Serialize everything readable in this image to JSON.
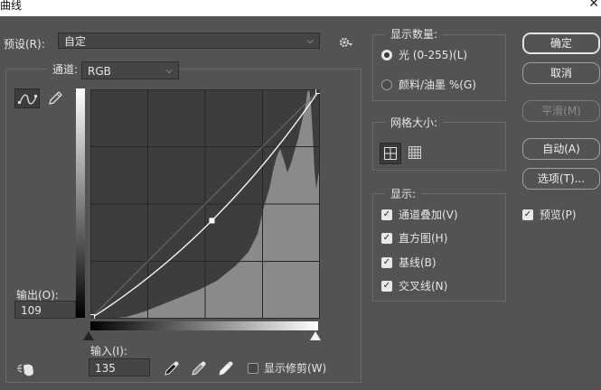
{
  "window": {
    "title": "曲线",
    "close_glyph": "✕"
  },
  "preset": {
    "label": "预设(R):",
    "value": "自定",
    "settings_icon": "gear-icon"
  },
  "channel": {
    "label": "通道:",
    "value": "RGB"
  },
  "tools": {
    "curve_tool": "curve-point-icon",
    "pencil_tool": "pencil-icon"
  },
  "output": {
    "label": "输出(O):",
    "value": "109"
  },
  "input": {
    "label": "输入(I):",
    "value": "135"
  },
  "eyedroppers": [
    "black-point-eyedropper-icon",
    "gray-point-eyedropper-icon",
    "white-point-eyedropper-icon"
  ],
  "show_clipping": {
    "label": "显示修剪(W)",
    "checked": false
  },
  "display_amount": {
    "title": "显示数量:",
    "light": "光 (0-255)(L)",
    "pigment": "颜料/油墨 %(G)",
    "selected": "light"
  },
  "grid_size": {
    "title": "网格大小:",
    "selected": "simple"
  },
  "show": {
    "title": "显示:",
    "items": [
      {
        "label": "通道叠加(V)",
        "checked": true
      },
      {
        "label": "直方图(H)",
        "checked": true
      },
      {
        "label": "基线(B)",
        "checked": true
      },
      {
        "label": "交叉线(N)",
        "checked": true
      }
    ]
  },
  "buttons": {
    "ok": "确定",
    "cancel": "取消",
    "smooth": "平滑(M)",
    "auto": "自动(A)",
    "options": "选项(T)..."
  },
  "preview": {
    "label": "预览(P)",
    "checked": true
  },
  "curve": {
    "input_min": 0,
    "input_max": 255,
    "control_point": {
      "input": 135,
      "output": 109
    },
    "endpoints": [
      [
        0,
        0
      ],
      [
        255,
        255
      ]
    ]
  },
  "colors": {
    "background": "#535353",
    "graph_bg": "#3d3d3d",
    "histogram": "#8a8a8a",
    "curve": "#ffffff"
  }
}
